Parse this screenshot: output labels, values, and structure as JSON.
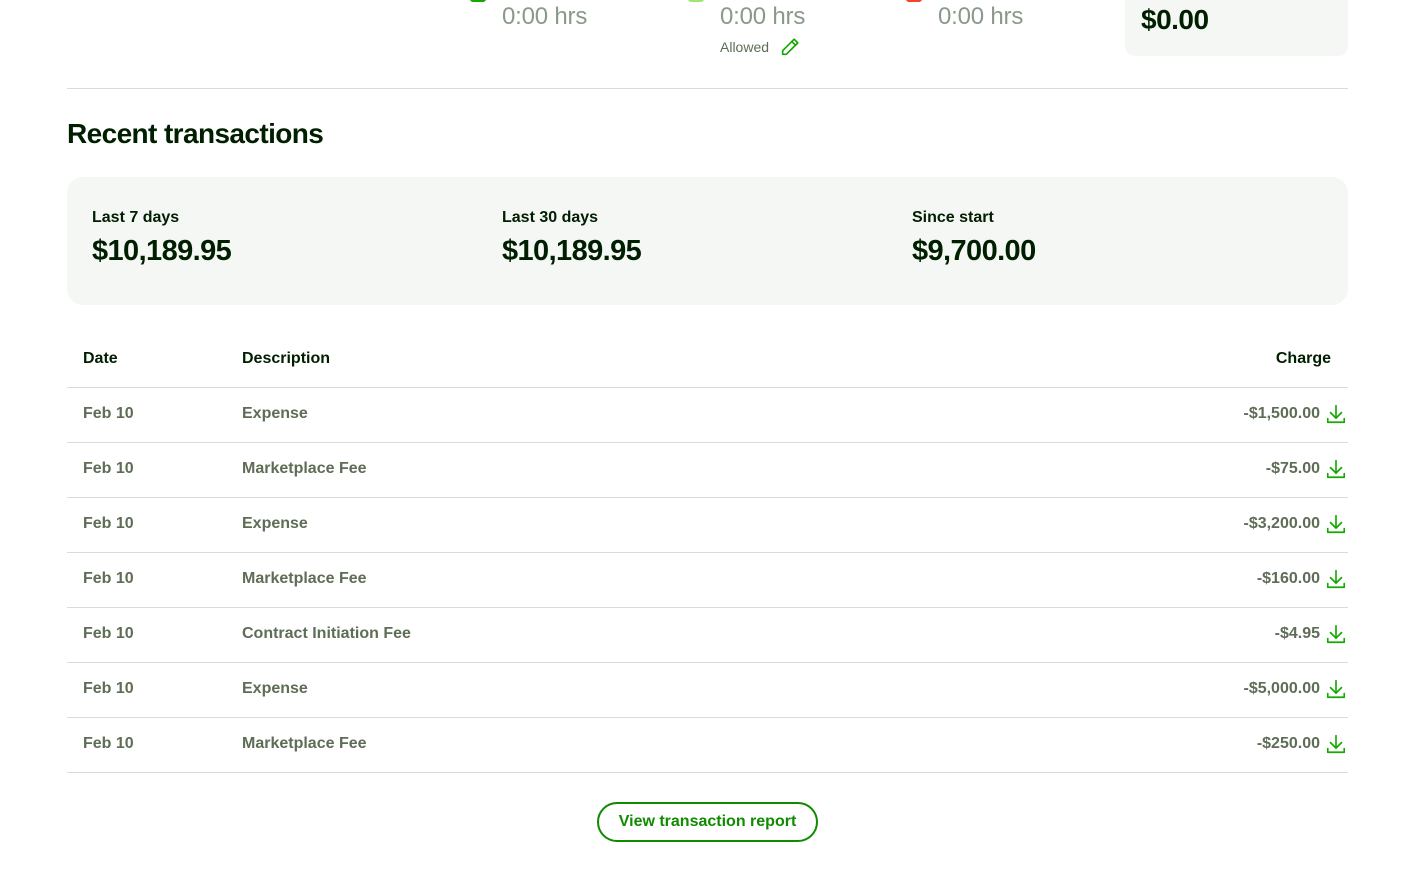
{
  "hours": [
    {
      "value": "0:00 hrs",
      "color": "#14a800"
    },
    {
      "value": "0:00 hrs",
      "color": "#9fe870",
      "allowed_label": "Allowed"
    },
    {
      "value": "0:00 hrs",
      "color": "#f4422b"
    }
  ],
  "balance": {
    "value": "$0.00"
  },
  "recent": {
    "title": "Recent transactions",
    "summary": [
      {
        "label": "Last 7 days",
        "value": "$10,189.95"
      },
      {
        "label": "Last 30 days",
        "value": "$10,189.95"
      },
      {
        "label": "Since start",
        "value": "$9,700.00"
      }
    ],
    "table": {
      "headers": {
        "date": "Date",
        "description": "Description",
        "charge": "Charge"
      },
      "rows": [
        {
          "date": "Feb 10",
          "description": "Expense",
          "charge": "-$1,500.00"
        },
        {
          "date": "Feb 10",
          "description": "Marketplace Fee",
          "charge": "-$75.00"
        },
        {
          "date": "Feb 10",
          "description": "Expense",
          "charge": "-$3,200.00"
        },
        {
          "date": "Feb 10",
          "description": "Marketplace Fee",
          "charge": "-$160.00"
        },
        {
          "date": "Feb 10",
          "description": "Contract Initiation Fee",
          "charge": "-$4.95"
        },
        {
          "date": "Feb 10",
          "description": "Expense",
          "charge": "-$5,000.00"
        },
        {
          "date": "Feb 10",
          "description": "Marketplace Fee",
          "charge": "-$250.00"
        }
      ]
    },
    "report_button": "View transaction report"
  },
  "colors": {
    "accent": "#108a00",
    "muted_text": "#5e6d55",
    "panel_bg": "#f5f7f5"
  },
  "icons": {
    "edit": "pencil-icon",
    "download": "download-icon"
  }
}
